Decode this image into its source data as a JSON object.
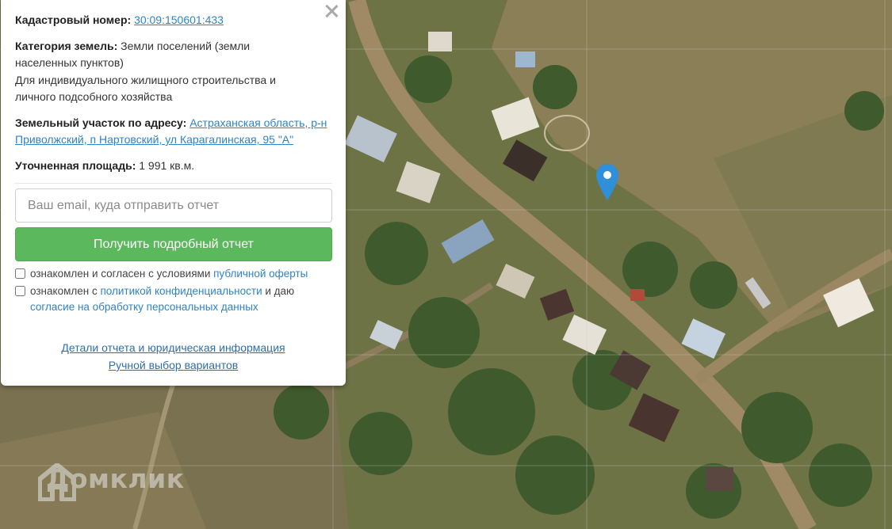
{
  "popup": {
    "cadastral_label": "Кадастровый номер:",
    "cadastral_value": "30:09:150601:433",
    "category_label": "Категория земель:",
    "category_value": "Земли поселений (земли населенных пунктов)",
    "usage_value": "Для индивидуального жилищного строительства и личного подсобного хозяйства",
    "address_label": "Земельный участок по адресу:",
    "address_value": "Астраханская область, р-н Приволжский, п Нартовский, ул Карагалинская, 95 \"А\"",
    "area_label": "Уточненная площадь:",
    "area_value": "1 991 кв.м.",
    "email_placeholder": "Ваш email, куда отправить отчет",
    "submit_label": "Получить подробный отчет",
    "agree1_text": "ознакомлен и согласен с условиями ",
    "agree1_link": "публичной оферты",
    "agree2_text": "ознакомлен с ",
    "agree2_link1": "политикой конфиденциальности",
    "agree2_mid": " и даю ",
    "agree2_link2": "согласие на обработку персональных данных",
    "details_link": "Детали отчета и юридическая информация",
    "manual_link": "Ручной выбор вариантов"
  },
  "map": {
    "watermark": "Домклик",
    "marker_color": "#2f8fd8",
    "button_color": "#5cb85c",
    "link_color": "#2f83c9"
  }
}
